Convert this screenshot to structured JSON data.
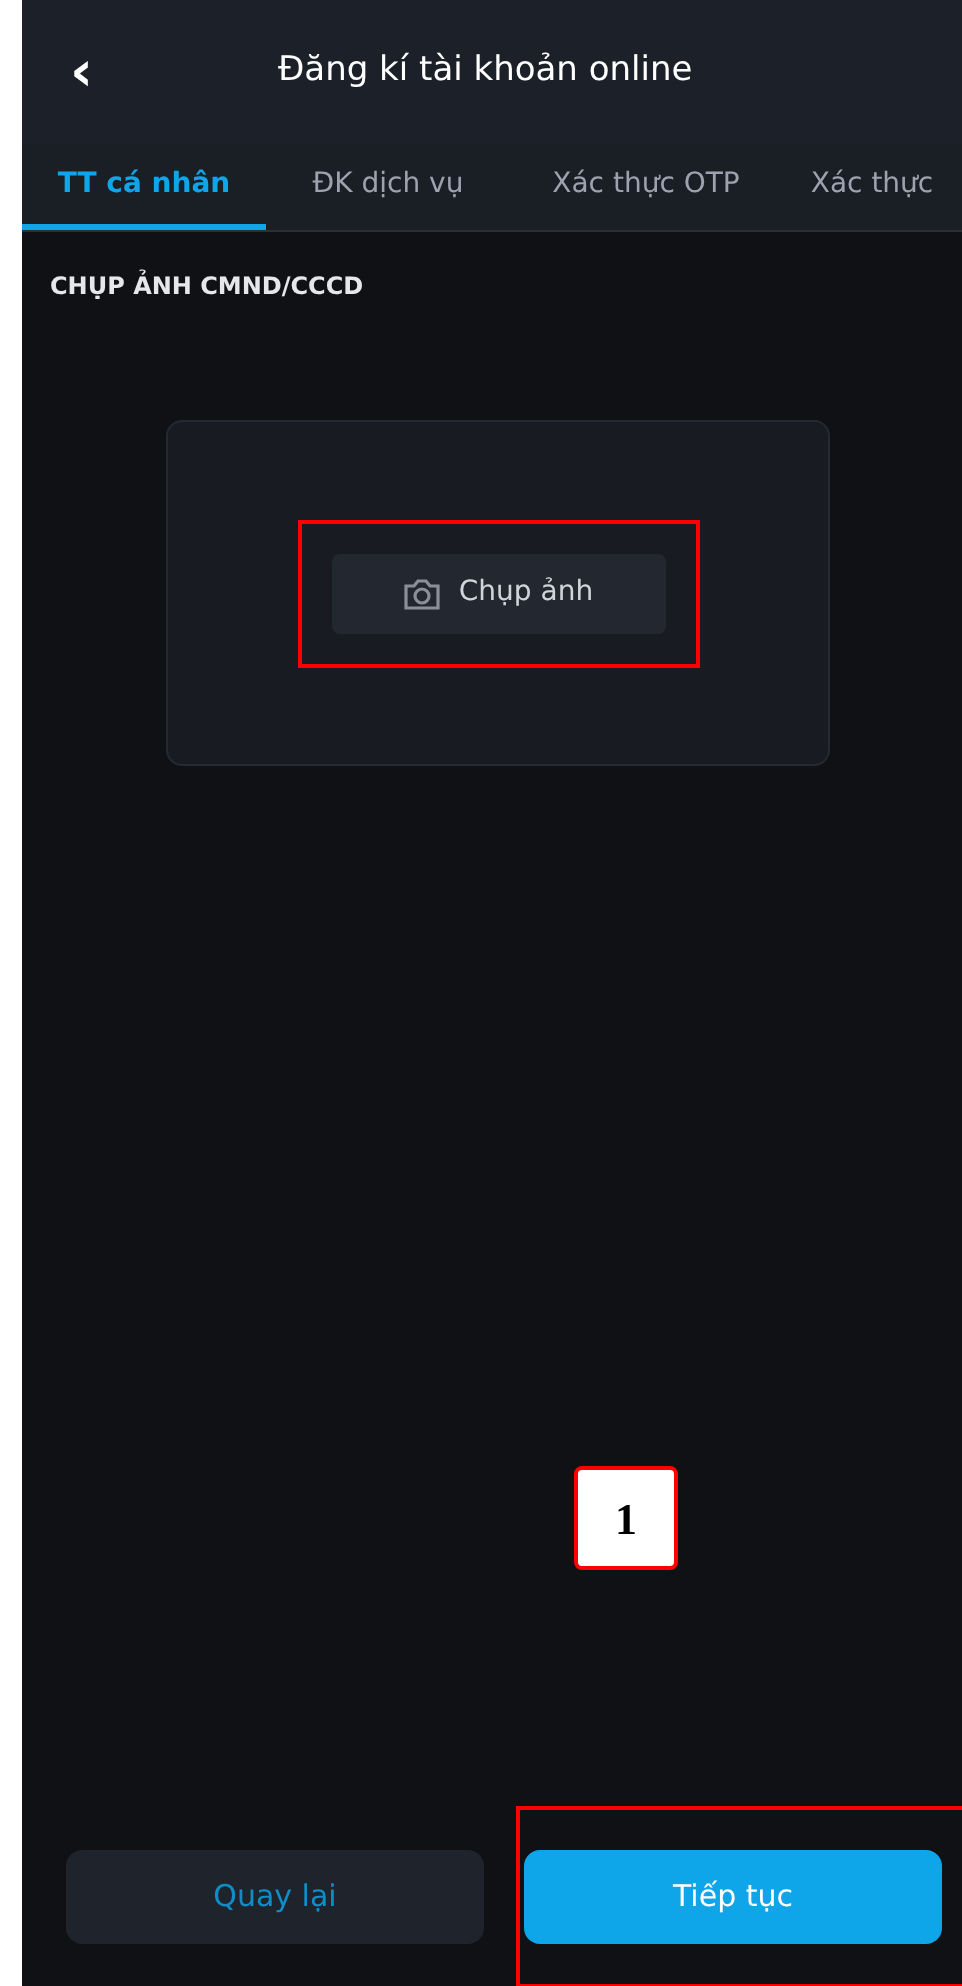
{
  "header": {
    "back": "‹",
    "title": "Đăng kí tài khoản online"
  },
  "tabs": [
    {
      "label": "TT cá nhân",
      "selected": true
    },
    {
      "label": "ĐK dịch vụ",
      "selected": false
    },
    {
      "label": "Xác thực OTP",
      "selected": false
    },
    {
      "label": "Xác thực",
      "selected": false
    }
  ],
  "section_title": "CHỤP ẢNH CMND/CCCD",
  "capture_button": "Chụp ảnh",
  "annotations": [
    {
      "label": "1"
    }
  ],
  "buttons": [
    {
      "label": "Quay lại",
      "kind": "secondary"
    },
    {
      "label": "Tiếp tục",
      "kind": "primary"
    }
  ]
}
